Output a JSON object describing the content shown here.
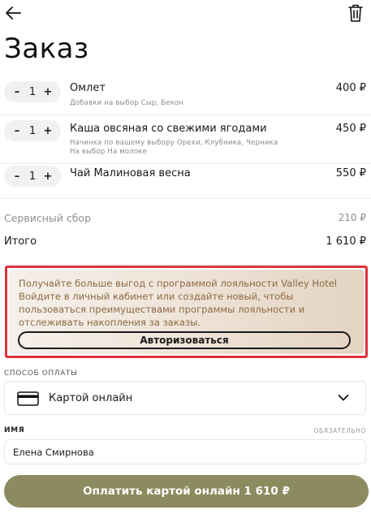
{
  "header": {
    "title": "Заказ",
    "back_icon": "arrow-left-icon",
    "trash_icon": "trash-icon"
  },
  "items": [
    {
      "name": "Омлет",
      "quantity": "1",
      "price": "400 ₽",
      "notes": [
        "Добавки на выбор Сыр,  Бекон"
      ]
    },
    {
      "name": "Каша овсяная со свежими ягодами",
      "quantity": "1",
      "price": "450 ₽",
      "notes": [
        "Начинка по вашему выбору Орехи,  Клубника,  Черника",
        "На выбор На молоке"
      ]
    },
    {
      "name": "Чай Малиновая весна",
      "quantity": "1",
      "price": "550 ₽",
      "notes": []
    }
  ],
  "stepper": {
    "minus": "–",
    "plus": "+"
  },
  "summary": {
    "service_label": "Сервисный сбор",
    "service_value": "210 ₽",
    "total_label": "Итого",
    "total_value": "1 610 ₽"
  },
  "loyalty": {
    "text": "Получайте больше выгод с программой лояльности Valley Hotel Войдите в личный кабинет или создайте новый, чтобы пользоваться преимуществами программы лояльности и отслеживать накопления за заказы.",
    "button_label": "Авторизоваться"
  },
  "payment": {
    "section_label": "СПОСОБ ОПЛАТЫ",
    "selected": "Картой онлайн",
    "icon": "credit-card-icon"
  },
  "name_field": {
    "label": "ИМЯ",
    "required_label": "ОБЯЗАТЕЛЬНО",
    "value": "Елена Смирнова"
  },
  "pay_button": {
    "label": "Оплатить картой онлайн 1 610 ₽"
  },
  "colors": {
    "accent_button": "#8b8b5f",
    "loyalty_border": "#e0313c",
    "loyalty_text": "#8a6a44"
  }
}
